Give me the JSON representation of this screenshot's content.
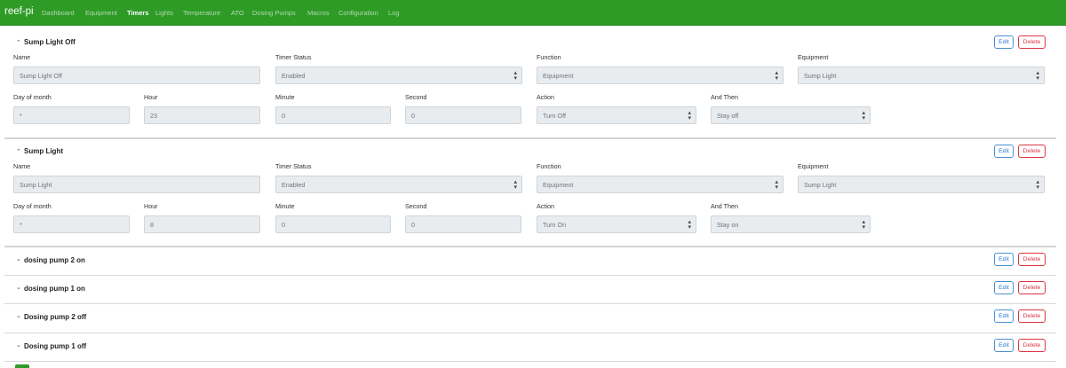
{
  "navbar": {
    "brand": "reef-pi",
    "items": [
      "Dashboard",
      "Equipment",
      "Timers",
      "Lights",
      "Temperature",
      "ATO",
      "Dosing Pumps",
      "Macros",
      "Configuration",
      "Log"
    ],
    "active": "Timers"
  },
  "labels": {
    "name": "Name",
    "timer_status": "Timer Status",
    "function": "Function",
    "equipment": "Equipment",
    "day_of_month": "Day of month",
    "hour": "Hour",
    "minute": "Minute",
    "second": "Second",
    "action": "Action",
    "and_then": "And Then"
  },
  "buttons": {
    "edit": "Edit",
    "delete": "Delete"
  },
  "icons": {
    "expanded": "chevron-up-icon",
    "collapsed": "chevron-down-icon",
    "select_caret": "select-caret-icon"
  },
  "timers": [
    {
      "title": "Sump Light Off",
      "expanded": true,
      "name": "Sump Light Off",
      "timer_status": "Enabled",
      "function": "Equipment",
      "equipment": "Sump Light",
      "day_of_month": "*",
      "hour": "23",
      "minute": "0",
      "second": "0",
      "action": "Turn Off",
      "and_then": "Stay off"
    },
    {
      "title": "Sump Light",
      "expanded": true,
      "name": "Sump Light",
      "timer_status": "Enabled",
      "function": "Equipment",
      "equipment": "Sump Light",
      "day_of_month": "*",
      "hour": "8",
      "minute": "0",
      "second": "0",
      "action": "Turn On",
      "and_then": "Stay on"
    },
    {
      "title": "dosing pump 2 on",
      "expanded": false
    },
    {
      "title": "dosing pump 1 on",
      "expanded": false
    },
    {
      "title": "Dosing pump 2 off",
      "expanded": false
    },
    {
      "title": "Dosing pump 1 off",
      "expanded": false
    }
  ]
}
